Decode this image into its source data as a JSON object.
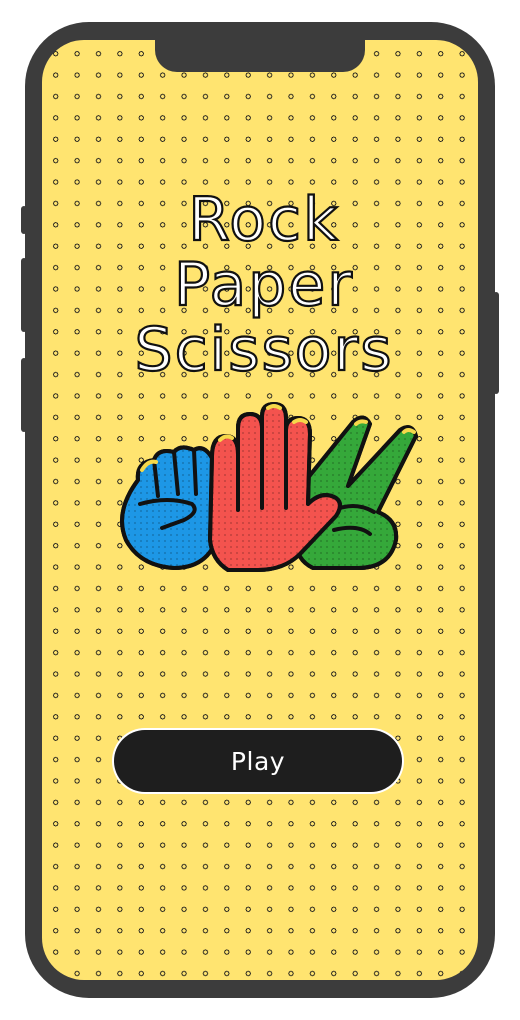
{
  "app": {
    "title_lines": [
      "Rock",
      "Paper",
      "Scissors"
    ]
  },
  "hands": {
    "rock": {
      "icon": "fist-icon",
      "color": "#1d97e6"
    },
    "paper": {
      "icon": "open-hand-icon",
      "color": "#f4534e"
    },
    "scissors": {
      "icon": "victory-hand-icon",
      "color": "#35a83a"
    }
  },
  "actions": {
    "play_label": "Play"
  },
  "colors": {
    "background": "#ffe470",
    "dots": "#1a1a1a",
    "phone_frame": "#3c3c3c",
    "button": "#1e1e1e",
    "button_text": "#ffffff"
  }
}
